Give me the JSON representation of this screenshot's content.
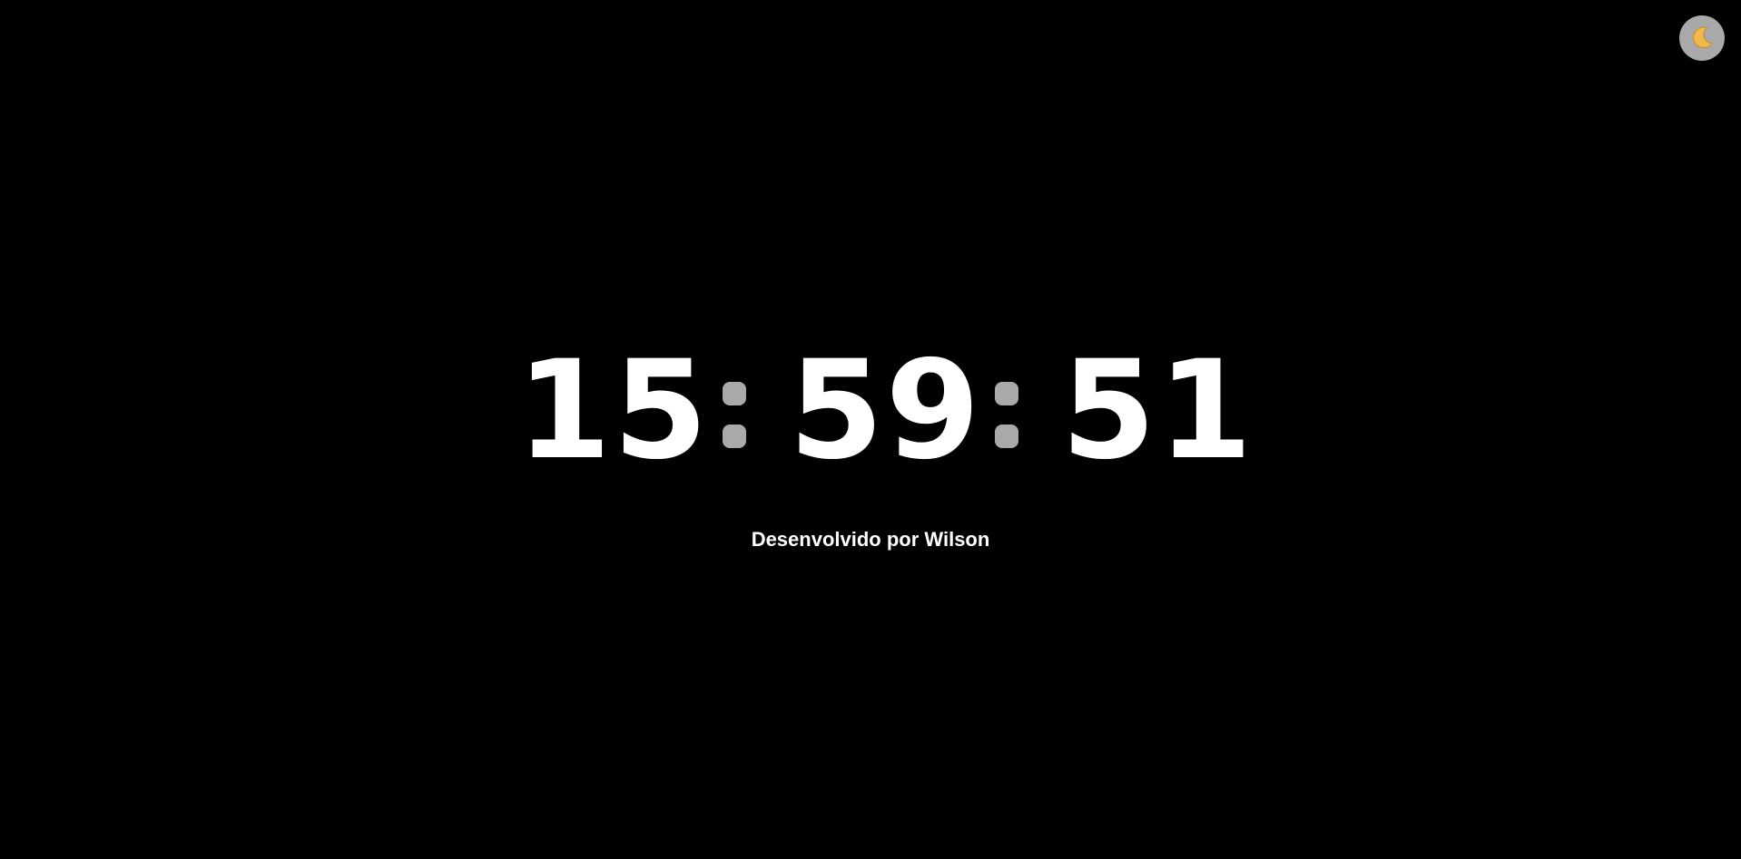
{
  "theme_toggle": {
    "icon": "crescent-moon-icon",
    "background_color": "#a9a9a9",
    "icon_color": "#f2b84b"
  },
  "clock": {
    "hours": "15",
    "minutes": "59",
    "seconds": "51",
    "digit_color": "#ffffff",
    "separator_color": "#a9a9a9"
  },
  "footer": {
    "credit": "Desenvolvido por Wilson"
  },
  "colors": {
    "background": "#000000",
    "text": "#ffffff"
  }
}
